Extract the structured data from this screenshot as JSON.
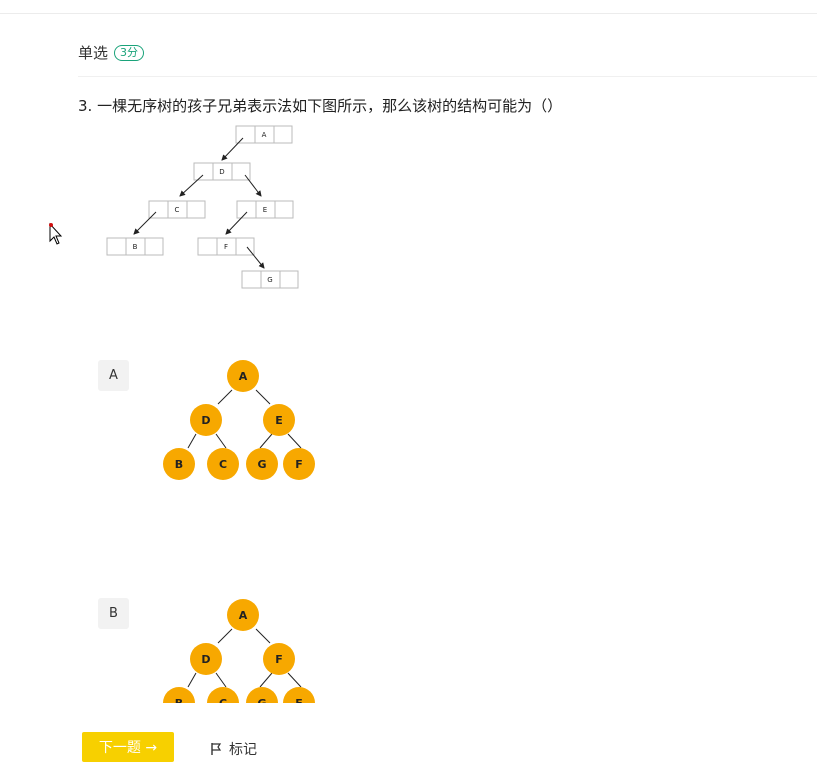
{
  "header": {
    "question_type": "单选",
    "score": "3分"
  },
  "question": {
    "text": "3. 一棵无序树的孩子兄弟表示法如下图所示，那么该树的结构可能为（）",
    "diagram_nodes": [
      "A",
      "D",
      "C",
      "E",
      "B",
      "F",
      "G"
    ]
  },
  "options": [
    {
      "label": "A",
      "tree": {
        "root": "A",
        "level2": [
          "D",
          "E"
        ],
        "level3": [
          "B",
          "C",
          "G",
          "F"
        ]
      }
    },
    {
      "label": "B",
      "tree": {
        "root": "A",
        "level2": [
          "D",
          "F"
        ],
        "level3": [
          "B",
          "C",
          "G",
          "E"
        ]
      }
    }
  ],
  "footer": {
    "next_label": "下一题 →",
    "mark_label": "标记"
  },
  "colors": {
    "node_fill": "#f7a800",
    "next_button": "#f7d000",
    "score_badge": "#1aa37a"
  }
}
